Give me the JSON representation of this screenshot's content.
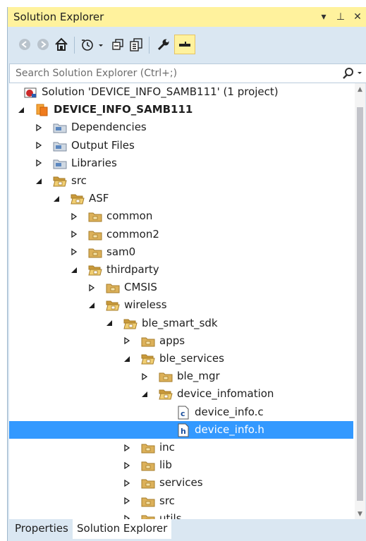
{
  "window": {
    "title": "Solution Explorer",
    "buttons": {
      "dropdown": "▾",
      "pin": "⊥",
      "close": "✕"
    }
  },
  "toolbar": {
    "icons": [
      "back-icon",
      "forward-icon",
      "home-icon",
      "history-icon",
      "collapse-all-icon",
      "show-all-files-icon",
      "properties-wrench-icon",
      "preview-icon"
    ]
  },
  "search": {
    "placeholder": "Search Solution Explorer (Ctrl+;)"
  },
  "tree": {
    "items": [
      {
        "label": "Solution 'DEVICE_INFO_SAMB111' (1 project)",
        "icon": "solution-icon",
        "indent": 0,
        "arrow": "none",
        "bold": false
      },
      {
        "label": "DEVICE_INFO_SAMB111",
        "icon": "project-icon",
        "indent": 1,
        "arrow": "expanded",
        "bold": true
      },
      {
        "label": "Dependencies",
        "icon": "virtual-folder-icon",
        "indent": 2,
        "arrow": "collapsed",
        "bold": false
      },
      {
        "label": "Output Files",
        "icon": "virtual-folder-icon",
        "indent": 2,
        "arrow": "collapsed",
        "bold": false
      },
      {
        "label": "Libraries",
        "icon": "virtual-folder-icon",
        "indent": 2,
        "arrow": "collapsed",
        "bold": false
      },
      {
        "label": "src",
        "icon": "folder-open-icon",
        "indent": 2,
        "arrow": "expanded",
        "bold": false
      },
      {
        "label": "ASF",
        "icon": "folder-open-icon",
        "indent": 3,
        "arrow": "expanded",
        "bold": false
      },
      {
        "label": "common",
        "icon": "folder-icon",
        "indent": 4,
        "arrow": "collapsed",
        "bold": false
      },
      {
        "label": "common2",
        "icon": "folder-icon",
        "indent": 4,
        "arrow": "collapsed",
        "bold": false
      },
      {
        "label": "sam0",
        "icon": "folder-icon",
        "indent": 4,
        "arrow": "collapsed",
        "bold": false
      },
      {
        "label": "thirdparty",
        "icon": "folder-open-icon",
        "indent": 4,
        "arrow": "expanded",
        "bold": false
      },
      {
        "label": "CMSIS",
        "icon": "folder-icon",
        "indent": 5,
        "arrow": "collapsed",
        "bold": false
      },
      {
        "label": "wireless",
        "icon": "folder-open-icon",
        "indent": 5,
        "arrow": "expanded",
        "bold": false
      },
      {
        "label": "ble_smart_sdk",
        "icon": "folder-open-icon",
        "indent": 6,
        "arrow": "expanded",
        "bold": false
      },
      {
        "label": "apps",
        "icon": "folder-icon",
        "indent": 7,
        "arrow": "collapsed",
        "bold": false
      },
      {
        "label": "ble_services",
        "icon": "folder-open-icon",
        "indent": 7,
        "arrow": "expanded",
        "bold": false
      },
      {
        "label": "ble_mgr",
        "icon": "folder-icon",
        "indent": 8,
        "arrow": "collapsed",
        "bold": false
      },
      {
        "label": "device_infomation",
        "icon": "folder-open-icon",
        "indent": 8,
        "arrow": "expanded",
        "bold": false
      },
      {
        "label": "device_info.c",
        "icon": "c-file-icon",
        "indent": 9,
        "arrow": "none",
        "bold": false
      },
      {
        "label": "device_info.h",
        "icon": "h-file-icon",
        "indent": 9,
        "arrow": "none",
        "bold": false,
        "selected": true
      },
      {
        "label": "inc",
        "icon": "folder-icon",
        "indent": 7,
        "arrow": "collapsed",
        "bold": false
      },
      {
        "label": "lib",
        "icon": "folder-icon",
        "indent": 7,
        "arrow": "collapsed",
        "bold": false
      },
      {
        "label": "services",
        "icon": "folder-icon",
        "indent": 7,
        "arrow": "collapsed",
        "bold": false
      },
      {
        "label": "src",
        "icon": "folder-icon",
        "indent": 7,
        "arrow": "collapsed",
        "bold": false
      },
      {
        "label": "utils",
        "icon": "folder-icon",
        "indent": 7,
        "arrow": "collapsed",
        "bold": false
      }
    ]
  },
  "tabs": {
    "properties": "Properties",
    "solution_explorer": "Solution Explorer"
  },
  "colors": {
    "title_bar": "#fff29d",
    "panel": "#dae7f2",
    "selection": "#3399ff",
    "folder": "#dcb15a"
  }
}
